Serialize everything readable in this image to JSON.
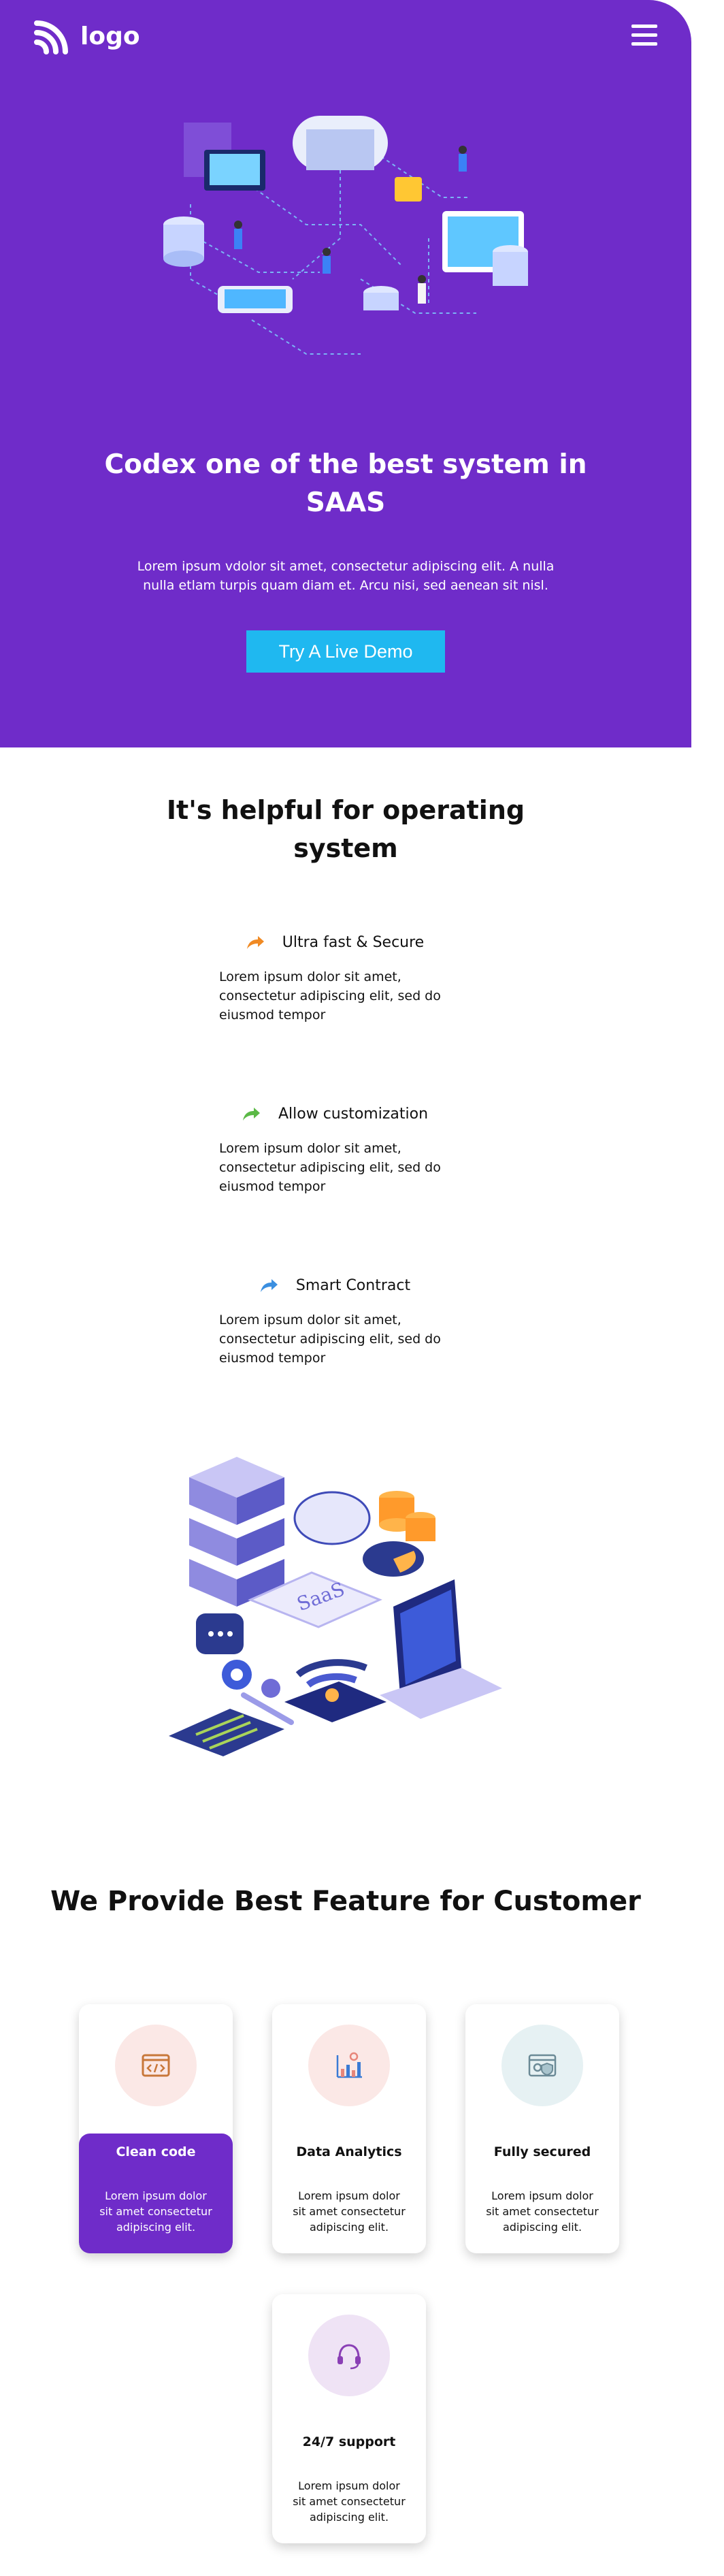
{
  "header": {
    "logo_text": "logo"
  },
  "hero": {
    "title": "Codex one of the best system in SAAS",
    "text": "Lorem ipsum vdolor sit amet, consectetur adipiscing elit. A nulla nulla etlam turpis quam diam et. Arcu nisi, sed aenean sit nisl.",
    "button_label": "Try A Live Demo"
  },
  "helpful": {
    "title": "It's helpful for operating system",
    "features": [
      {
        "title": "Ultra fast & Secure",
        "text": "Lorem ipsum dolor sit amet, consectetur adipiscing elit, sed do eiusmod tempor",
        "icon": "share-arrow-icon",
        "color": "#f08a24"
      },
      {
        "title": "Allow customization",
        "text": "Lorem ipsum dolor sit amet, consectetur adipiscing elit, sed do eiusmod tempor",
        "icon": "share-arrow-icon",
        "color": "#5bb946"
      },
      {
        "title": "Smart Contract",
        "text": "Lorem ipsum dolor sit amet, consectetur adipiscing elit, sed do eiusmod tempor",
        "icon": "share-arrow-icon",
        "color": "#3b8fe0"
      }
    ]
  },
  "features_section": {
    "title": "We Provide Best Feature for Customer",
    "cards": [
      {
        "title": "Clean code",
        "text": "Lorem ipsum dolor sit amet consectetur adipiscing elit.",
        "icon": "code-window-icon",
        "active": true
      },
      {
        "title": "Data Analytics",
        "text": "Lorem ipsum dolor sit amet consectetur adipiscing elit.",
        "icon": "analytics-chart-icon",
        "active": false
      },
      {
        "title": "Fully secured",
        "text": "Lorem ipsum dolor sit amet consectetur adipiscing elit.",
        "icon": "secure-browser-icon",
        "active": false
      },
      {
        "title": "24/7 support",
        "text": "Lorem ipsum dolor sit amet consectetur adipiscing elit.",
        "icon": "headset-icon",
        "active": false
      }
    ]
  },
  "colors": {
    "brand_purple": "#6f2cc9",
    "button_blue": "#1fb8f0"
  }
}
